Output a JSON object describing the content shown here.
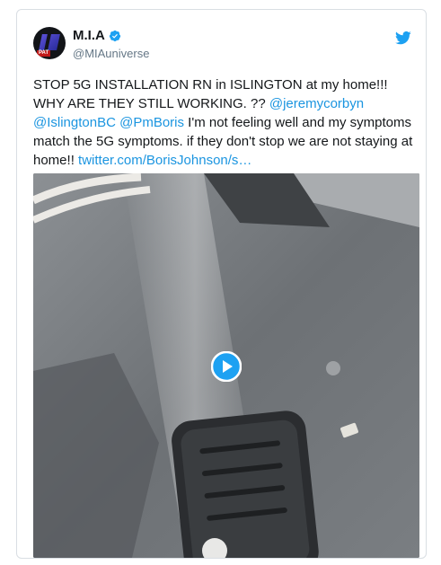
{
  "tweet": {
    "display_name": "M.I.A",
    "handle": "@MIAuniverse",
    "avatar_tag": "PAT",
    "text_plain_1": "STOP 5G INSTALLATION RN in ISLINGTON at my home!!! WHY ARE THEY STILL WORKING. ?? ",
    "mention_1": "@jeremycorbyn",
    "mention_2": "@IslingtonBC",
    "mention_3": "@PmBoris",
    "text_plain_2": "  I'm not feeling well and my symptoms match the 5G symptoms. if they don't stop we are not staying at home!! ",
    "link": "twitter.com/BorisJohnson/s…"
  },
  "icons": {
    "verified": "verified-badge-icon",
    "bird": "twitter-bird-icon",
    "play": "play-icon"
  },
  "colors": {
    "link": "#1b95e0",
    "handle": "#657786",
    "accent": "#1da1f2"
  }
}
